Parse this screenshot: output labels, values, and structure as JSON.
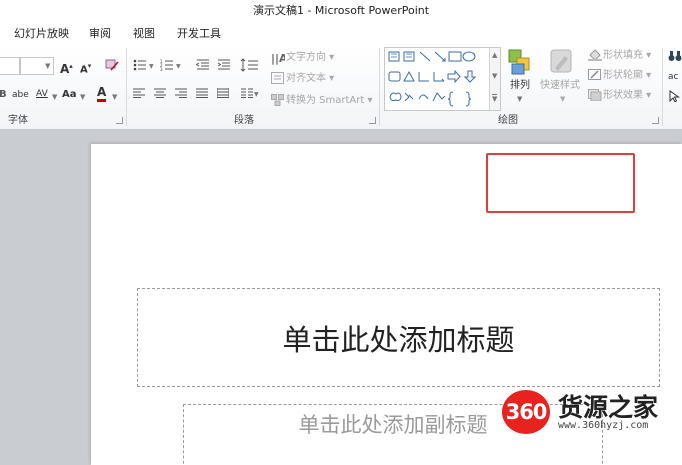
{
  "window": {
    "title": "演示文稿1 - Microsoft PowerPoint"
  },
  "tabs": [
    {
      "label": "幻灯片放映"
    },
    {
      "label": "审阅"
    },
    {
      "label": "视图"
    },
    {
      "label": "开发工具"
    }
  ],
  "ribbon": {
    "font_group": {
      "label": "字体",
      "grow": "A",
      "shrink": "A",
      "spacing": "AV",
      "case": "Aa",
      "color": "A",
      "shadow": "abe"
    },
    "paragraph_group": {
      "label": "段落",
      "text_direction": "文字方向",
      "align_text": "对齐文本",
      "convert_smartart": "转换为 SmartArt"
    },
    "drawing_group": {
      "label": "绘图",
      "arrange": "排列",
      "quick_styles": "快速样式",
      "shape_fill": "形状填充",
      "shape_outline": "形状轮廓",
      "shape_effects": "形状效果"
    }
  },
  "slide": {
    "title_placeholder": "单击此处添加标题",
    "subtitle_placeholder": "单击此处添加副标题"
  },
  "watermark": {
    "badge": "360",
    "name": "货源之家",
    "url": "www.360hyzj.com"
  },
  "colors": {
    "highlight": "#d9403e",
    "badge": "#e8231d"
  }
}
